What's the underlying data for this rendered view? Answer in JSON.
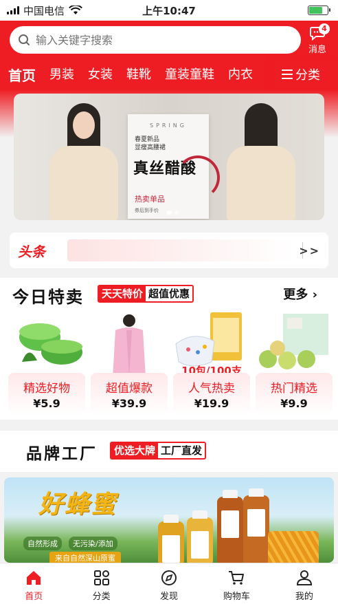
{
  "status_bar": {
    "carrier": "中国电信",
    "time": "上午10:47"
  },
  "search": {
    "placeholder": "输入关键字搜索"
  },
  "messages": {
    "label": "消息",
    "badge": "4"
  },
  "tabs": [
    "首页",
    "男装",
    "女装",
    "鞋靴",
    "童装童鞋",
    "内衣"
  ],
  "tabs_more": "分类",
  "banner": {
    "spring": "SPRING",
    "poster_small": "春夏新品\n显瘦高腰裙",
    "poster_title": "真丝醋酸",
    "poster_tag": "热卖单品",
    "poster_foot": "券后到手价"
  },
  "headline": {
    "logo": "头条",
    "arrow": ">>"
  },
  "today": {
    "title": "今日特卖",
    "tag_primary": "天天特价",
    "tag_secondary": "超值优惠",
    "more": "更多",
    "products": [
      {
        "name": "精选好物",
        "price": "¥5.9"
      },
      {
        "name": "超值爆款",
        "price": "¥39.9"
      },
      {
        "name": "人气热卖",
        "price": "¥19.9",
        "overlay": "10包/100支"
      },
      {
        "name": "热门精选",
        "price": "¥9.9"
      }
    ]
  },
  "brand": {
    "title": "品牌工厂",
    "tag_primary": "优选大牌",
    "tag_secondary": "工厂直发"
  },
  "honey": {
    "title": "好蜂蜜",
    "sub1": "自然形成",
    "sub2": "无污染/添加",
    "foot": "来自自然深山原蜜"
  },
  "bottom_nav": [
    "首页",
    "分类",
    "发现",
    "购物车",
    "我的"
  ],
  "colors": {
    "brand_red": "#ee1d23",
    "battery_green": "#41c25a",
    "honey_gold": "#f2b515"
  }
}
